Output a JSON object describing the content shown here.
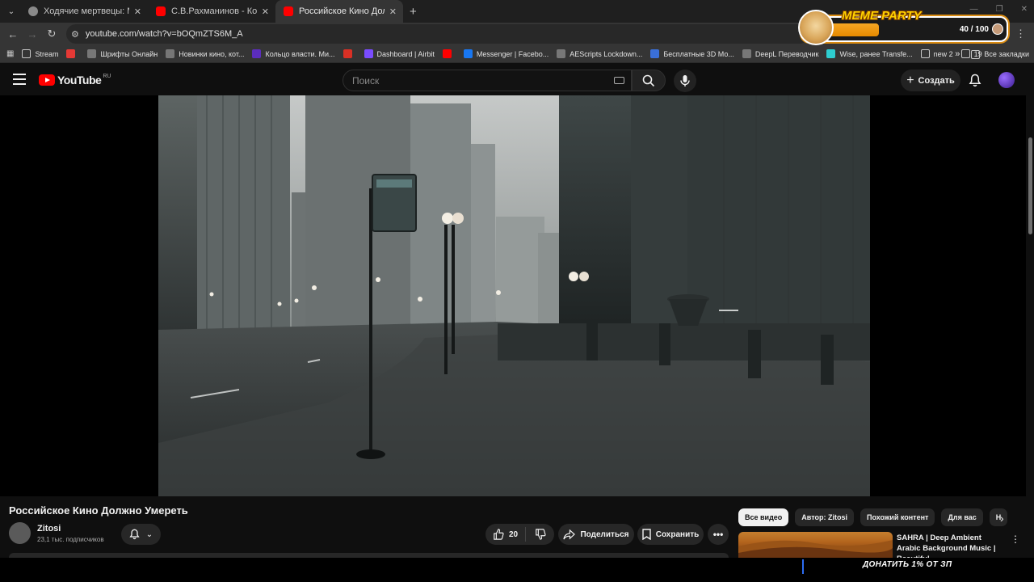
{
  "browser": {
    "tabs": [
      {
        "title": "Ходячие мертвецы: Мертвый",
        "favicon_color": "#8a8a8a"
      },
      {
        "title": "С.В.Рахманинов - Концерт №",
        "favicon_color": "#ff0000"
      },
      {
        "title": "Российское Кино Должно Уме",
        "favicon_color": "#ff0000",
        "active": true
      }
    ],
    "url": "youtube.com/watch?v=bOQmZTS6M_A",
    "bookmarks": [
      {
        "label": "Stream",
        "icon": "folder-icon"
      },
      {
        "label": "",
        "icon": "red-badge-icon",
        "color": "#e53935"
      },
      {
        "label": "Шрифты Онлайн",
        "icon": "font-icon"
      },
      {
        "label": "Новинки кино, кот...",
        "icon": "film-icon"
      },
      {
        "label": "Кольцо власти. Ми...",
        "icon": "r-icon",
        "color": "#5b2dbd"
      },
      {
        "label": "",
        "icon": "gmail-icon",
        "color": "#d93025"
      },
      {
        "label": "Dashboard | Airbit",
        "icon": "airbit-icon",
        "color": "#7a4cff"
      },
      {
        "label": "",
        "icon": "youtube-icon",
        "color": "#ff0000"
      },
      {
        "label": "Messenger | Facebo...",
        "icon": "facebook-icon",
        "color": "#1877f2"
      },
      {
        "label": "AEScripts Lockdown...",
        "icon": "ae-icon"
      },
      {
        "label": "Бесплатные 3D Мо...",
        "icon": "3d-icon",
        "color": "#3a6fd8"
      },
      {
        "label": "DeepL Переводчик",
        "icon": "deepl-icon"
      },
      {
        "label": "Wise, ранее Transfe...",
        "icon": "wise-icon",
        "color": "#2ecdd0"
      },
      {
        "label": "new 2",
        "icon": "folder-icon"
      },
      {
        "label": "19",
        "icon": "folder-icon"
      }
    ],
    "bookmarks_overflow": "»",
    "all_bookmarks": "Все закладки"
  },
  "overlay": {
    "meme_title": "MEME PARTY",
    "meme_count": "40 / 100",
    "meme_progress_fraction": 0.4,
    "donate": "ДОНАТИТЬ 1% ОТ ЗП"
  },
  "youtube": {
    "logo_text": "YouTube",
    "region": "RU",
    "search_placeholder": "Поиск",
    "create_label": "Создать"
  },
  "video": {
    "title": "Российское Кино Должно Умереть",
    "channel": "Zitosi",
    "subscribers": "23,1 тыс. подписчиков",
    "likes": "20",
    "share_label": "Поделиться",
    "save_label": "Сохранить"
  },
  "sidebar": {
    "chips": [
      "Все видео",
      "Автор: Zitosi",
      "Похожий контент",
      "Для вас",
      "Н"
    ],
    "recommendation": {
      "title": "SAHRA | Deep Ambient Arabic Background Music | Beautiful ..."
    }
  }
}
